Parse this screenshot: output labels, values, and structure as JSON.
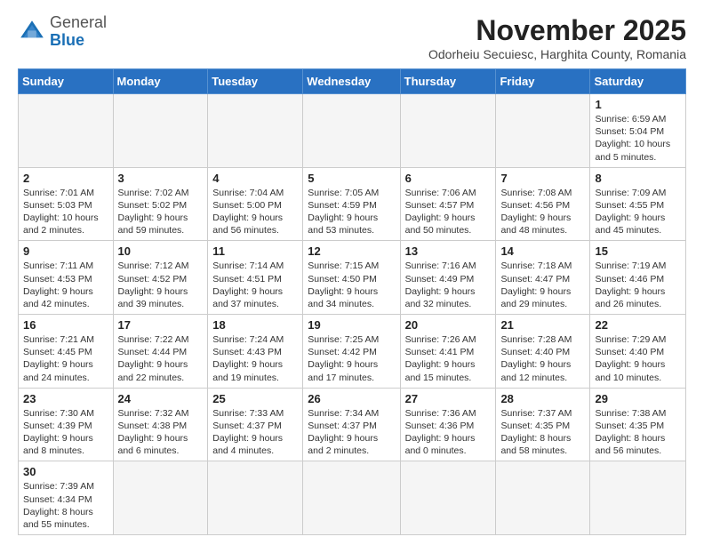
{
  "logo": {
    "general": "General",
    "blue": "Blue"
  },
  "title": "November 2025",
  "subtitle": "Odorheiu Secuiesc, Harghita County, Romania",
  "days_of_week": [
    "Sunday",
    "Monday",
    "Tuesday",
    "Wednesday",
    "Thursday",
    "Friday",
    "Saturday"
  ],
  "weeks": [
    [
      {
        "day": "",
        "info": ""
      },
      {
        "day": "",
        "info": ""
      },
      {
        "day": "",
        "info": ""
      },
      {
        "day": "",
        "info": ""
      },
      {
        "day": "",
        "info": ""
      },
      {
        "day": "",
        "info": ""
      },
      {
        "day": "1",
        "info": "Sunrise: 6:59 AM\nSunset: 5:04 PM\nDaylight: 10 hours and 5 minutes."
      }
    ],
    [
      {
        "day": "2",
        "info": "Sunrise: 7:01 AM\nSunset: 5:03 PM\nDaylight: 10 hours and 2 minutes."
      },
      {
        "day": "3",
        "info": "Sunrise: 7:02 AM\nSunset: 5:02 PM\nDaylight: 9 hours and 59 minutes."
      },
      {
        "day": "4",
        "info": "Sunrise: 7:04 AM\nSunset: 5:00 PM\nDaylight: 9 hours and 56 minutes."
      },
      {
        "day": "5",
        "info": "Sunrise: 7:05 AM\nSunset: 4:59 PM\nDaylight: 9 hours and 53 minutes."
      },
      {
        "day": "6",
        "info": "Sunrise: 7:06 AM\nSunset: 4:57 PM\nDaylight: 9 hours and 50 minutes."
      },
      {
        "day": "7",
        "info": "Sunrise: 7:08 AM\nSunset: 4:56 PM\nDaylight: 9 hours and 48 minutes."
      },
      {
        "day": "8",
        "info": "Sunrise: 7:09 AM\nSunset: 4:55 PM\nDaylight: 9 hours and 45 minutes."
      }
    ],
    [
      {
        "day": "9",
        "info": "Sunrise: 7:11 AM\nSunset: 4:53 PM\nDaylight: 9 hours and 42 minutes."
      },
      {
        "day": "10",
        "info": "Sunrise: 7:12 AM\nSunset: 4:52 PM\nDaylight: 9 hours and 39 minutes."
      },
      {
        "day": "11",
        "info": "Sunrise: 7:14 AM\nSunset: 4:51 PM\nDaylight: 9 hours and 37 minutes."
      },
      {
        "day": "12",
        "info": "Sunrise: 7:15 AM\nSunset: 4:50 PM\nDaylight: 9 hours and 34 minutes."
      },
      {
        "day": "13",
        "info": "Sunrise: 7:16 AM\nSunset: 4:49 PM\nDaylight: 9 hours and 32 minutes."
      },
      {
        "day": "14",
        "info": "Sunrise: 7:18 AM\nSunset: 4:47 PM\nDaylight: 9 hours and 29 minutes."
      },
      {
        "day": "15",
        "info": "Sunrise: 7:19 AM\nSunset: 4:46 PM\nDaylight: 9 hours and 26 minutes."
      }
    ],
    [
      {
        "day": "16",
        "info": "Sunrise: 7:21 AM\nSunset: 4:45 PM\nDaylight: 9 hours and 24 minutes."
      },
      {
        "day": "17",
        "info": "Sunrise: 7:22 AM\nSunset: 4:44 PM\nDaylight: 9 hours and 22 minutes."
      },
      {
        "day": "18",
        "info": "Sunrise: 7:24 AM\nSunset: 4:43 PM\nDaylight: 9 hours and 19 minutes."
      },
      {
        "day": "19",
        "info": "Sunrise: 7:25 AM\nSunset: 4:42 PM\nDaylight: 9 hours and 17 minutes."
      },
      {
        "day": "20",
        "info": "Sunrise: 7:26 AM\nSunset: 4:41 PM\nDaylight: 9 hours and 15 minutes."
      },
      {
        "day": "21",
        "info": "Sunrise: 7:28 AM\nSunset: 4:40 PM\nDaylight: 9 hours and 12 minutes."
      },
      {
        "day": "22",
        "info": "Sunrise: 7:29 AM\nSunset: 4:40 PM\nDaylight: 9 hours and 10 minutes."
      }
    ],
    [
      {
        "day": "23",
        "info": "Sunrise: 7:30 AM\nSunset: 4:39 PM\nDaylight: 9 hours and 8 minutes."
      },
      {
        "day": "24",
        "info": "Sunrise: 7:32 AM\nSunset: 4:38 PM\nDaylight: 9 hours and 6 minutes."
      },
      {
        "day": "25",
        "info": "Sunrise: 7:33 AM\nSunset: 4:37 PM\nDaylight: 9 hours and 4 minutes."
      },
      {
        "day": "26",
        "info": "Sunrise: 7:34 AM\nSunset: 4:37 PM\nDaylight: 9 hours and 2 minutes."
      },
      {
        "day": "27",
        "info": "Sunrise: 7:36 AM\nSunset: 4:36 PM\nDaylight: 9 hours and 0 minutes."
      },
      {
        "day": "28",
        "info": "Sunrise: 7:37 AM\nSunset: 4:35 PM\nDaylight: 8 hours and 58 minutes."
      },
      {
        "day": "29",
        "info": "Sunrise: 7:38 AM\nSunset: 4:35 PM\nDaylight: 8 hours and 56 minutes."
      }
    ],
    [
      {
        "day": "30",
        "info": "Sunrise: 7:39 AM\nSunset: 4:34 PM\nDaylight: 8 hours and 55 minutes."
      },
      {
        "day": "",
        "info": ""
      },
      {
        "day": "",
        "info": ""
      },
      {
        "day": "",
        "info": ""
      },
      {
        "day": "",
        "info": ""
      },
      {
        "day": "",
        "info": ""
      },
      {
        "day": "",
        "info": ""
      }
    ]
  ]
}
